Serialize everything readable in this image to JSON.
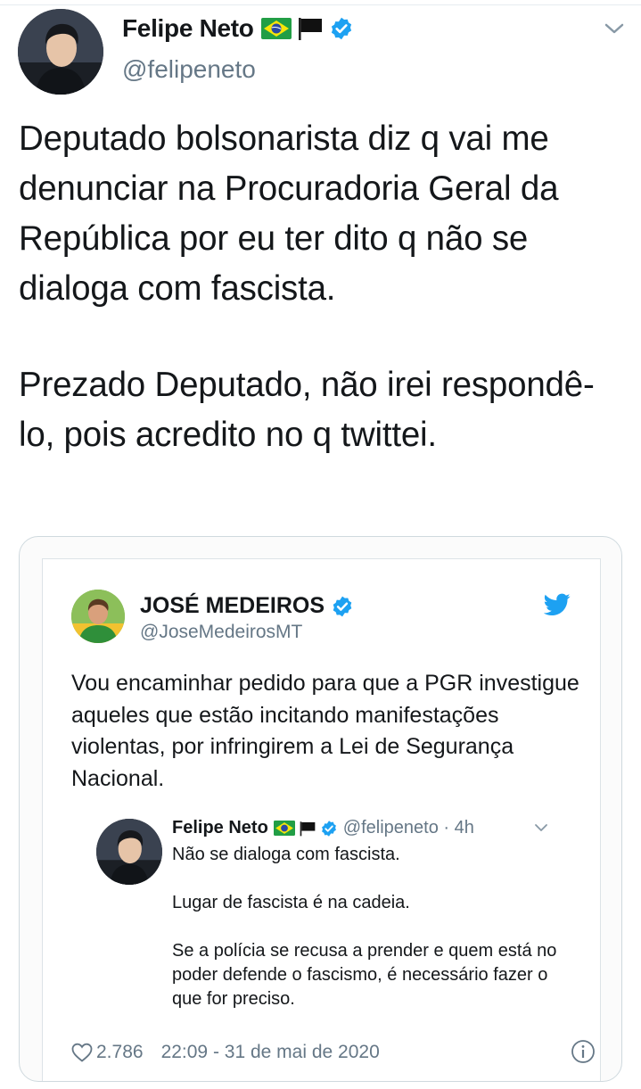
{
  "tweet": {
    "author_name": "Felipe Neto",
    "author_handle": "@felipeneto",
    "flags": [
      "brazil-flag",
      "black-flag"
    ],
    "verified": true,
    "text_paragraphs": [
      "Deputado bolsonarista diz q vai me denunciar na Procuradoria Geral da República por eu ter dito q não se dialoga com fascista.",
      "Prezado Deputado, não irei respondê-lo, pois acredito no q twittei."
    ]
  },
  "embedded": {
    "author_name": "JOSÉ MEDEIROS",
    "author_handle": "@JoseMedeirosMT",
    "verified": true,
    "text": "Vou encaminhar pedido para que a PGR investigue aqueles que estão incitando manifestações violentas, por infringirem a Lei de Segurança Nacional.",
    "quoted": {
      "author_name": "Felipe Neto",
      "author_handle_time": "@felipeneto · 4h",
      "paragraphs": [
        "Não se dialoga com fascista.",
        "Lugar de fascista é na cadeia.",
        "Se a polícia se recusa a prender e quem está no poder defende o fascismo, é necessário fazer o que for preciso."
      ]
    },
    "likes": "2.786",
    "timestamp": "22:09 - 31 de mai de 2020"
  },
  "colors": {
    "text": "#14171a",
    "secondary": "#657786",
    "verified_blue": "#1da1f2",
    "border": "#cfd9de"
  }
}
